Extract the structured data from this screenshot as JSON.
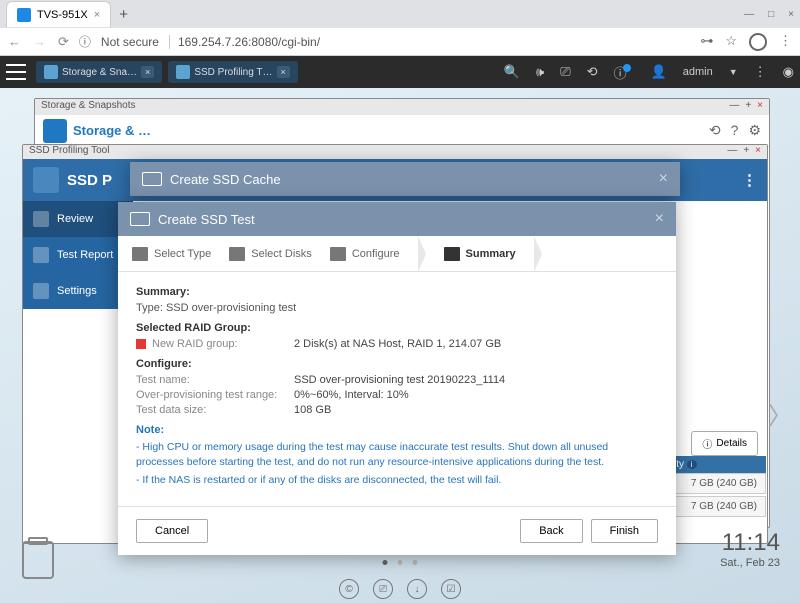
{
  "browser": {
    "tab_title": "TVS-951X",
    "url_security": "Not secure",
    "url": "169.254.7.26:8080/cgi-bin/"
  },
  "topbar": {
    "tasks": [
      "Storage & Sna…",
      "SSD Profiling T…"
    ],
    "user": "admin"
  },
  "windows": {
    "storage_title": "Storage & Snapshots",
    "storage_header": "Storage & …",
    "profiling_title": "SSD Profiling Tool",
    "profiling_header": "SSD P"
  },
  "sidebar": {
    "items": [
      "Review",
      "Test Report",
      "Settings"
    ]
  },
  "cache_modal": {
    "title": "Create SSD Cache"
  },
  "test_modal": {
    "title": "Create SSD Test",
    "steps": [
      "Select Type",
      "Select Disks",
      "Configure",
      "Summary"
    ],
    "summary_heading": "Summary:",
    "type_line": "Type: SSD over-provisioning test",
    "raid_heading": "Selected RAID Group:",
    "raid_name": "New RAID group:",
    "raid_value": "2 Disk(s) at NAS Host, RAID 1, 214.07 GB",
    "configure_heading": "Configure:",
    "test_name_k": "Test name:",
    "test_name_v": "SSD over-provisioning test 20190223_1114",
    "range_k": "Over-provisioning test range:",
    "range_v": "0%~60%, Interval: 10%",
    "size_k": "Test data size:",
    "size_v": "108 GB",
    "note_heading": "Note:",
    "note1": "- High CPU or memory usage during the test may cause inaccurate test results. Shut down all unused processes before starting the test, and do not run any resource-intensive applications during the test.",
    "note2": "- If the NAS is restarted or if any of the disks are disconnected, the test will fail.",
    "cancel": "Cancel",
    "back": "Back",
    "finish": "Finish"
  },
  "side_panel": {
    "details": "Details",
    "capacity_hdr": "ity",
    "disk1": "7 GB (240 GB)",
    "disk2": "7 GB (240 GB)"
  },
  "clock": {
    "time": "11:14",
    "date": "Sat., Feb 23"
  }
}
